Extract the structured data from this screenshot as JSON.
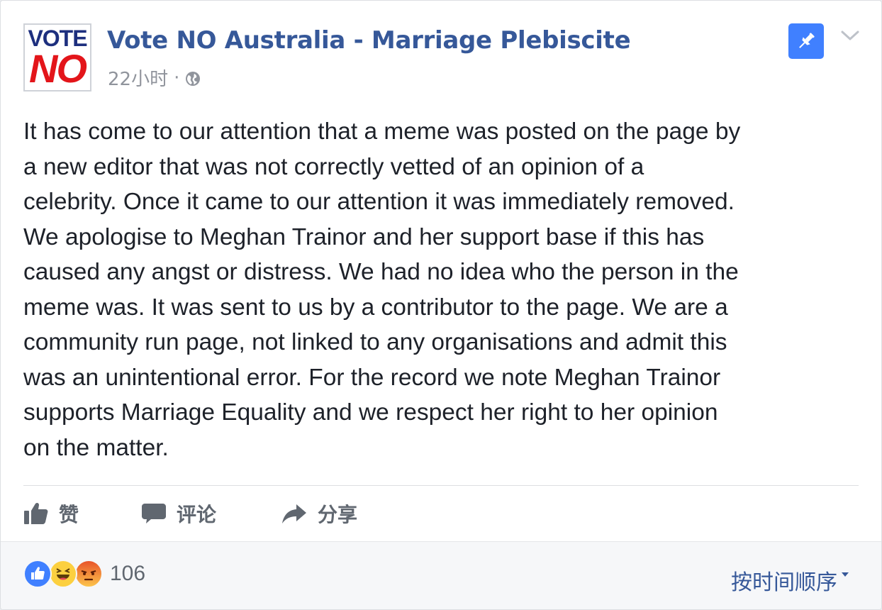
{
  "post": {
    "page_name": "Vote NO Australia - Marriage Plebiscite",
    "timestamp": "22小时",
    "separator": "·",
    "avatar": {
      "line1": "VOTE",
      "line2": "NO"
    },
    "body": "It has come to our attention that a meme was posted on the page by\na new editor that was not correctly vetted of an opinion of a\ncelebrity. Once it came to our attention it was immediately removed.\nWe apologise to Meghan Trainor and her support base if this has\ncaused any angst or distress. We had no idea who the person in the\nmeme was. It was sent to us by a contributor to the page. We are a\ncommunity run page, not linked to any organisations and admit this\nwas an unintentional error. For the record we note Meghan Trainor\nsupports Marriage Equality and we respect her right to her opinion\non the matter."
  },
  "icons": {
    "privacy": "globe-icon",
    "pin": "pin-icon",
    "menu": "chevron-down-icon",
    "like": "thumbs-up-icon",
    "comment": "comment-bubble-icon",
    "share": "share-arrow-icon"
  },
  "actions": {
    "like_label": "赞",
    "comment_label": "评论",
    "share_label": "分享"
  },
  "reactions": {
    "types": [
      "like",
      "haha",
      "angry"
    ],
    "count": "106"
  },
  "sort": {
    "label": "按时间顺序"
  },
  "colors": {
    "link_blue": "#365899",
    "pin_blue": "#4080ff",
    "text": "#1d2129",
    "secondary": "#90949c",
    "logo_red": "#e3151a",
    "logo_navy": "#1d2f7e"
  }
}
